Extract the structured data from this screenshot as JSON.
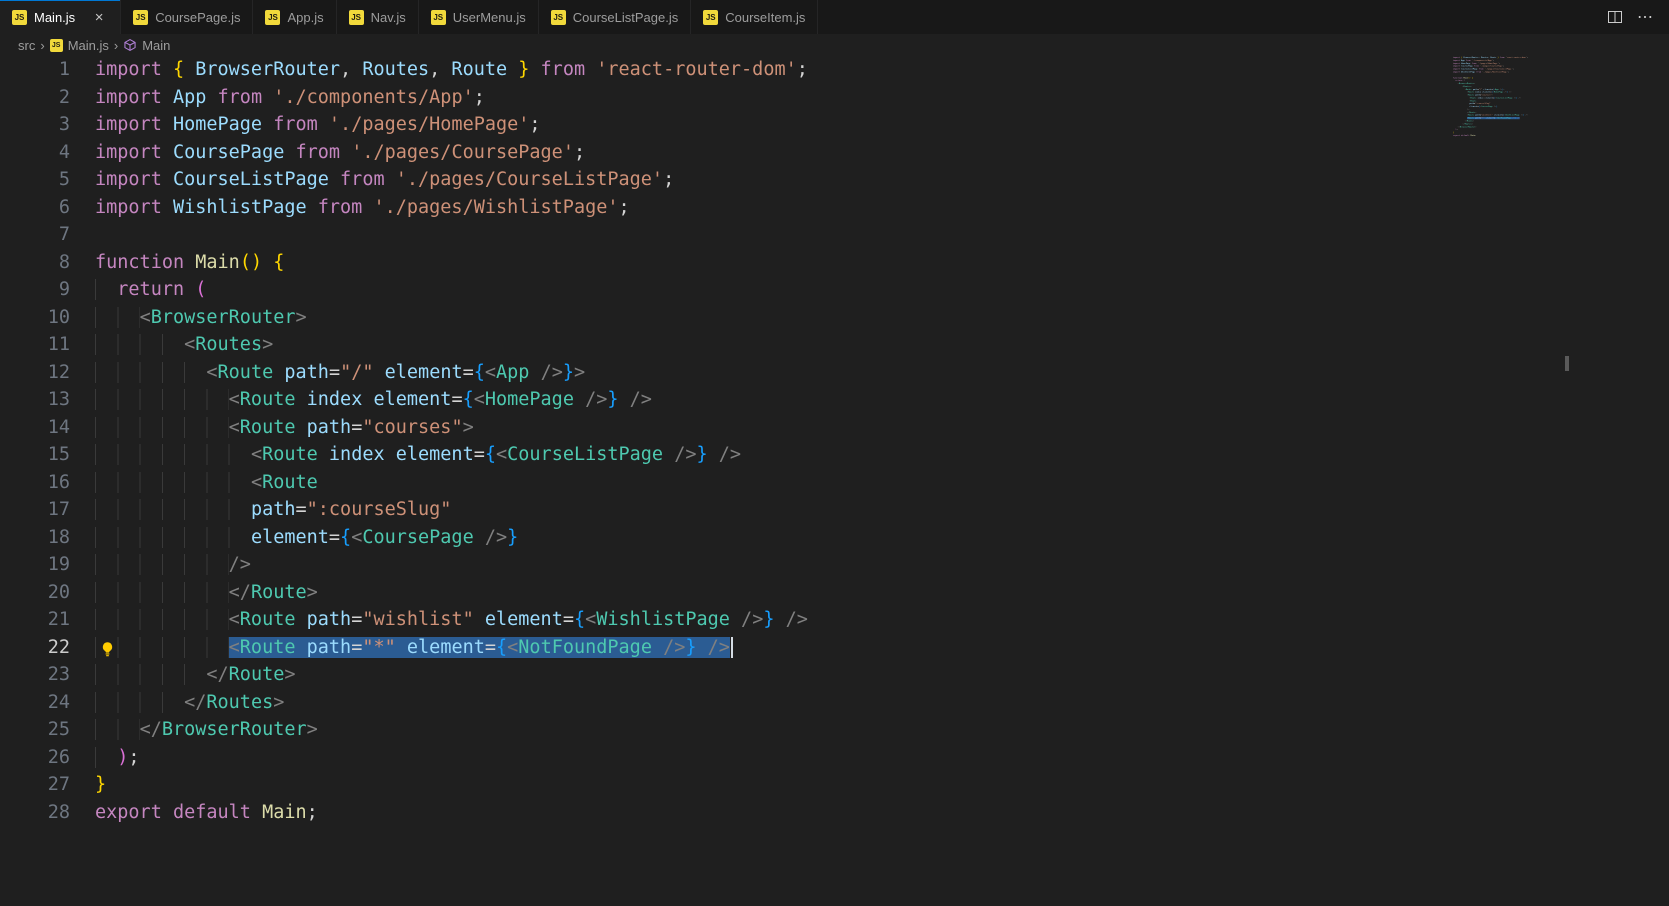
{
  "colors": {
    "editor_bg": "#1f1f1f",
    "tabbar_bg": "#181818",
    "tab_border": "#252526",
    "accent": "#0078d4",
    "tab_active_fg": "#ffffff",
    "tab_inactive_fg": "#9d9d9d",
    "breadcrumb_fg": "#9d9d9d",
    "selection": "#2b5c93",
    "cursor": "#d4dce4",
    "line_number": "#6e7681",
    "line_number_active": "#cccccc",
    "guide": "#3a3a3a",
    "keyword": "#c586c0",
    "variable": "#9cdcfe",
    "string": "#ce9178",
    "tag": "#4ec9b0",
    "attr": "#9cdcfe",
    "plain": "#d4d4d4",
    "angle": "#808080",
    "bracket1": "#ffd700",
    "bracket2": "#da70d6",
    "bracket3": "#179fff",
    "func": "#dcdcaa",
    "lightbulb": "#ffcc00",
    "js_icon_bg": "#f1d93b",
    "method_icon": "#b180d7"
  },
  "tab_bar": {
    "js_icon_text": "JS",
    "close_glyph": "×",
    "tabs": [
      {
        "label": "Main.js",
        "active": true
      },
      {
        "label": "CoursePage.js",
        "active": false
      },
      {
        "label": "App.js",
        "active": false
      },
      {
        "label": "Nav.js",
        "active": false
      },
      {
        "label": "UserMenu.js",
        "active": false
      },
      {
        "label": "CourseListPage.js",
        "active": false
      },
      {
        "label": "CourseItem.js",
        "active": false
      }
    ],
    "actions": {
      "more_glyph": "⋯"
    }
  },
  "breadcrumb": {
    "separator": "›",
    "items": [
      {
        "label": "src",
        "icon": null
      },
      {
        "label": "Main.js",
        "icon": "js"
      },
      {
        "label": "Main",
        "icon": "symbol-method"
      }
    ]
  },
  "editor": {
    "total_lines": 28,
    "active_line": 22,
    "selection_line": 22,
    "lightbulb_line": 22,
    "lines": [
      [
        [
          "kw",
          "import"
        ],
        [
          "plain",
          " "
        ],
        [
          "b1",
          "{"
        ],
        [
          "var",
          " BrowserRouter"
        ],
        [
          "plain",
          ","
        ],
        [
          "var",
          " Routes"
        ],
        [
          "plain",
          ","
        ],
        [
          "var",
          " Route"
        ],
        [
          "plain",
          " "
        ],
        [
          "b1",
          "}"
        ],
        [
          "kw",
          " from"
        ],
        [
          "str",
          " 'react-router-dom'"
        ],
        [
          "plain",
          ";"
        ]
      ],
      [
        [
          "kw",
          "import"
        ],
        [
          "var",
          " App"
        ],
        [
          "kw",
          " from"
        ],
        [
          "str",
          " './components/App'"
        ],
        [
          "plain",
          ";"
        ]
      ],
      [
        [
          "kw",
          "import"
        ],
        [
          "var",
          " HomePage"
        ],
        [
          "kw",
          " from"
        ],
        [
          "str",
          " './pages/HomePage'"
        ],
        [
          "plain",
          ";"
        ]
      ],
      [
        [
          "kw",
          "import"
        ],
        [
          "var",
          " CoursePage"
        ],
        [
          "kw",
          " from"
        ],
        [
          "str",
          " './pages/CoursePage'"
        ],
        [
          "plain",
          ";"
        ]
      ],
      [
        [
          "kw",
          "import"
        ],
        [
          "var",
          " CourseListPage"
        ],
        [
          "kw",
          " from"
        ],
        [
          "str",
          " './pages/CourseListPage'"
        ],
        [
          "plain",
          ";"
        ]
      ],
      [
        [
          "kw",
          "import"
        ],
        [
          "var",
          " WishlistPage"
        ],
        [
          "kw",
          " from"
        ],
        [
          "str",
          " './pages/WishlistPage'"
        ],
        [
          "plain",
          ";"
        ]
      ],
      [],
      [
        [
          "kw",
          "function"
        ],
        [
          "fn",
          " Main"
        ],
        [
          "b1",
          "()"
        ],
        [
          "plain",
          " "
        ],
        [
          "b1",
          "{"
        ]
      ],
      [
        [
          "kw",
          "  return"
        ],
        [
          "plain",
          " "
        ],
        [
          "b2",
          "("
        ]
      ],
      [
        [
          "angle",
          "    <"
        ],
        [
          "tag",
          "BrowserRouter"
        ],
        [
          "angle",
          ">"
        ]
      ],
      [
        [
          "angle",
          "        <"
        ],
        [
          "tag",
          "Routes"
        ],
        [
          "angle",
          ">"
        ]
      ],
      [
        [
          "angle",
          "          <"
        ],
        [
          "tag",
          "Route"
        ],
        [
          "attr",
          " path"
        ],
        [
          "plain",
          "="
        ],
        [
          "str",
          "\"/\""
        ],
        [
          "attr",
          " element"
        ],
        [
          "plain",
          "="
        ],
        [
          "b3",
          "{"
        ],
        [
          "angle",
          "<"
        ],
        [
          "tag",
          "App"
        ],
        [
          "angle",
          " />"
        ],
        [
          "b3",
          "}"
        ],
        [
          "angle",
          ">"
        ]
      ],
      [
        [
          "angle",
          "            <"
        ],
        [
          "tag",
          "Route"
        ],
        [
          "attr",
          " index"
        ],
        [
          "attr",
          " element"
        ],
        [
          "plain",
          "="
        ],
        [
          "b3",
          "{"
        ],
        [
          "angle",
          "<"
        ],
        [
          "tag",
          "HomePage"
        ],
        [
          "angle",
          " />"
        ],
        [
          "b3",
          "}"
        ],
        [
          "angle",
          " />"
        ]
      ],
      [
        [
          "angle",
          "            <"
        ],
        [
          "tag",
          "Route"
        ],
        [
          "attr",
          " path"
        ],
        [
          "plain",
          "="
        ],
        [
          "str",
          "\"courses\""
        ],
        [
          "angle",
          ">"
        ]
      ],
      [
        [
          "angle",
          "              <"
        ],
        [
          "tag",
          "Route"
        ],
        [
          "attr",
          " index"
        ],
        [
          "attr",
          " element"
        ],
        [
          "plain",
          "="
        ],
        [
          "b3",
          "{"
        ],
        [
          "angle",
          "<"
        ],
        [
          "tag",
          "CourseListPage"
        ],
        [
          "angle",
          " />"
        ],
        [
          "b3",
          "}"
        ],
        [
          "angle",
          " />"
        ]
      ],
      [
        [
          "angle",
          "              <"
        ],
        [
          "tag",
          "Route"
        ]
      ],
      [
        [
          "attr",
          "              path"
        ],
        [
          "plain",
          "="
        ],
        [
          "str",
          "\":courseSlug\""
        ]
      ],
      [
        [
          "attr",
          "              element"
        ],
        [
          "plain",
          "="
        ],
        [
          "b3",
          "{"
        ],
        [
          "angle",
          "<"
        ],
        [
          "tag",
          "CoursePage"
        ],
        [
          "angle",
          " />"
        ],
        [
          "b3",
          "}"
        ]
      ],
      [
        [
          "angle",
          "            />"
        ]
      ],
      [
        [
          "angle",
          "            </"
        ],
        [
          "tag",
          "Route"
        ],
        [
          "angle",
          ">"
        ]
      ],
      [
        [
          "angle",
          "            <"
        ],
        [
          "tag",
          "Route"
        ],
        [
          "attr",
          " path"
        ],
        [
          "plain",
          "="
        ],
        [
          "str",
          "\"wishlist\""
        ],
        [
          "attr",
          " element"
        ],
        [
          "plain",
          "="
        ],
        [
          "b3",
          "{"
        ],
        [
          "angle",
          "<"
        ],
        [
          "tag",
          "WishlistPage"
        ],
        [
          "angle",
          " />"
        ],
        [
          "b3",
          "}"
        ],
        [
          "angle",
          " />"
        ]
      ],
      [
        [
          "angle",
          "            <"
        ],
        [
          "tag",
          "Route"
        ],
        [
          "attr",
          " path"
        ],
        [
          "plain",
          "="
        ],
        [
          "str",
          "\"*\""
        ],
        [
          "attr",
          " element"
        ],
        [
          "plain",
          "="
        ],
        [
          "b3",
          "{"
        ],
        [
          "angle",
          "<"
        ],
        [
          "tag",
          "NotFoundPage"
        ],
        [
          "angle",
          " />"
        ],
        [
          "b3",
          "}"
        ],
        [
          "angle",
          " />"
        ]
      ],
      [
        [
          "angle",
          "          </"
        ],
        [
          "tag",
          "Route"
        ],
        [
          "angle",
          ">"
        ]
      ],
      [
        [
          "angle",
          "        </"
        ],
        [
          "tag",
          "Routes"
        ],
        [
          "angle",
          ">"
        ]
      ],
      [
        [
          "angle",
          "    </"
        ],
        [
          "tag",
          "BrowserRouter"
        ],
        [
          "angle",
          ">"
        ]
      ],
      [
        [
          "b2",
          "  )"
        ],
        [
          "plain",
          ";"
        ]
      ],
      [
        [
          "b1",
          "}"
        ]
      ],
      [
        [
          "kw",
          "export"
        ],
        [
          "kw",
          " default"
        ],
        [
          "fn",
          " Main"
        ],
        [
          "plain",
          ";"
        ]
      ]
    ]
  }
}
